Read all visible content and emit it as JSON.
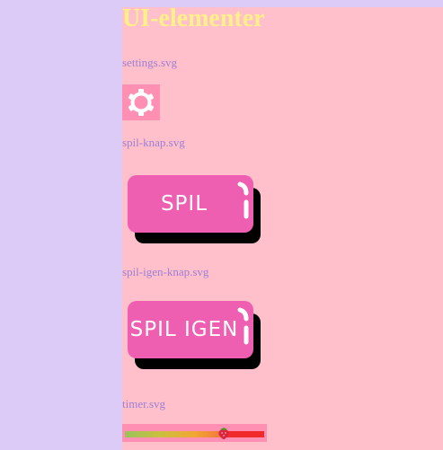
{
  "page": {
    "title": "UI-elementer"
  },
  "elements": [
    {
      "caption": "settings.svg",
      "icon": "gear-icon"
    },
    {
      "caption": "spil-knap.svg",
      "button_label": "SPIL"
    },
    {
      "caption": "spil-igen-knap.svg",
      "button_label": "SPIL IGEN"
    },
    {
      "caption": "timer.svg",
      "progress": 0.71,
      "marker_icon": "strawberry-icon"
    }
  ],
  "colors": {
    "page_background": "#dccbf7",
    "panel_background": "#ffc0cb",
    "title": "#fff08a",
    "caption": "#9b7fd6",
    "button_face": "#ee5fb1",
    "button_shadow": "#000000",
    "icon_box": "#ff8fb3",
    "timer_end": "#f02a2a"
  }
}
